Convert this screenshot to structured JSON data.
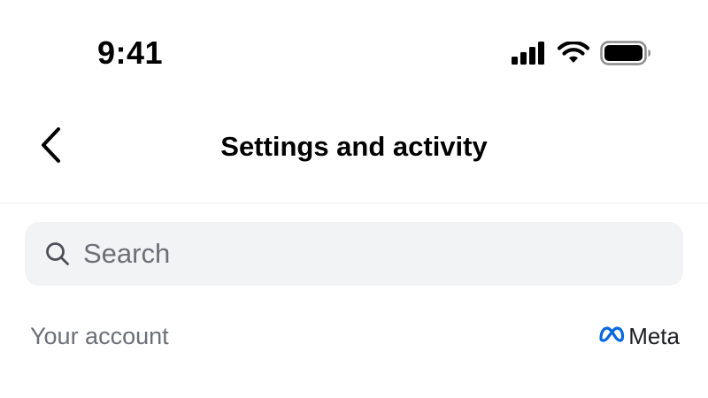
{
  "status_bar": {
    "time": "9:41",
    "icons": [
      "cellular-signal-icon",
      "wifi-icon",
      "battery-icon"
    ]
  },
  "header": {
    "back_icon": "chevron-left-icon",
    "title": "Settings and activity"
  },
  "search": {
    "icon": "search-icon",
    "placeholder": "Search",
    "value": ""
  },
  "section": {
    "title": "Your account",
    "brand_label": "Meta",
    "brand_icon": "meta-logo-icon"
  },
  "colors": {
    "background": "#ffffff",
    "search_bg": "#f2f3f5",
    "secondary_text": "#6b6f76",
    "divider": "#ececec",
    "meta_blue": "#0668E1"
  }
}
